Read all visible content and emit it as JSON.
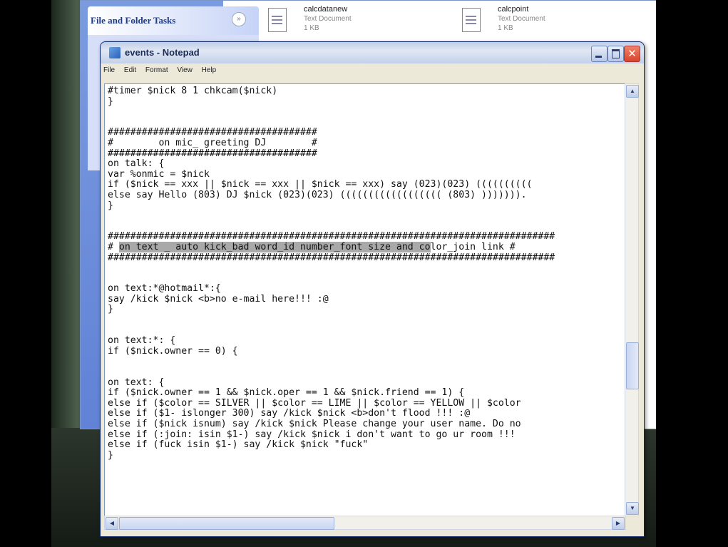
{
  "explorer": {
    "task_title": "File and Folder Tasks",
    "collapse_glyph": "»",
    "files": [
      {
        "name": "calcdatanew",
        "type": "Text Document",
        "size": "1 KB"
      },
      {
        "name": "calcpoint",
        "type": "Text Document",
        "size": "1 KB"
      }
    ]
  },
  "notepad": {
    "title": "events - Notepad",
    "close_glyph": "✕",
    "menu": [
      "File",
      "Edit",
      "Format",
      "View",
      "Help"
    ],
    "lines": [
      "#timer $nick 8 1 chkcam($nick)",
      "}",
      "",
      "",
      "#####################################",
      "#        on mic_ greeting DJ        #",
      "#####################################",
      "on talk: {",
      "var %onmic = $nick",
      "if ($nick == xxx || $nick == xxx || $nick == xxx) say (023)(023) ((((((((((",
      "else say Hello (803) DJ $nick (023)(023) (((((((((((((((((( (803) ))))))).",
      "}",
      "",
      "",
      "###############################################################################",
      "# on text _ auto kick_bad word_id number_font size and color_join link #",
      "###############################################################################",
      "",
      "",
      "on text:*@hotmail*:{",
      "say /kick $nick <b>no e-mail here!!! :@",
      "}",
      "",
      "",
      "on text:*: {",
      "if ($nick.owner == 0) {",
      "",
      "",
      "on text: {",
      "if ($nick.owner == 1 && $nick.oper == 1 && $nick.friend == 1) {",
      "else if ($color == SILVER || $color == LIME || $color == YELLOW || $color",
      "else if ($1- islonger 300) say /kick $nick <b>don't flood !!! :@",
      "else if ($nick isnum) say /kick $nick Please change your user name. Do no",
      "else if (:join: isin $1-) say /kick $nick i don't want to go ur room !!!",
      "else if (fuck isin $1-) say /kick $nick \"fuck\"",
      "}"
    ],
    "selection": {
      "line": 15,
      "text": "on text _ auto kick_bad word_id number_font size and co"
    }
  }
}
